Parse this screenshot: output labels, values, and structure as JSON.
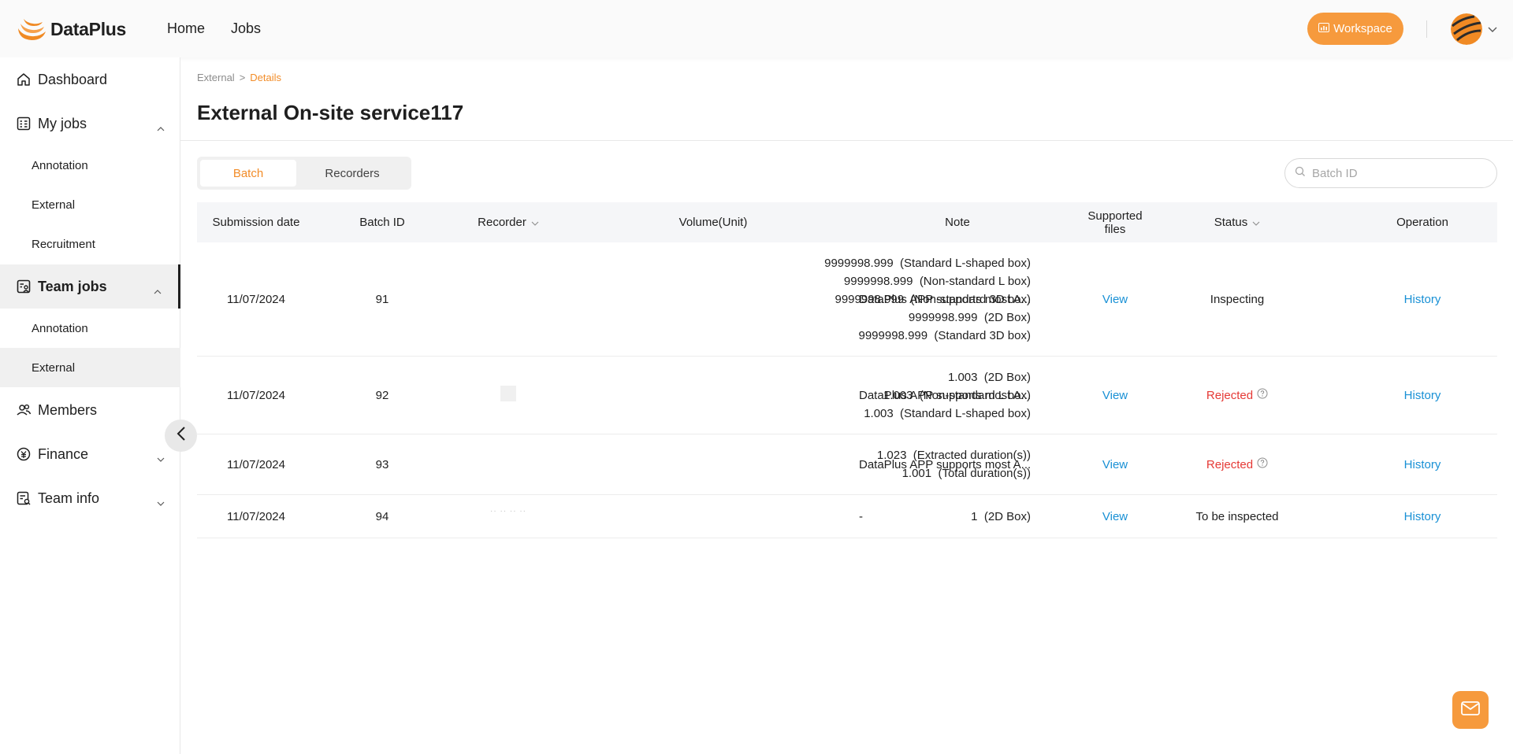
{
  "app": {
    "name": "DataPlus"
  },
  "topnav": [
    {
      "label": "Home"
    },
    {
      "label": "Jobs"
    }
  ],
  "header": {
    "workspace_label": "Workspace"
  },
  "sidebar": {
    "dashboard": "Dashboard",
    "my_jobs": "My jobs",
    "my_jobs_items": [
      "Annotation",
      "External",
      "Recruitment"
    ],
    "team_jobs": "Team jobs",
    "team_jobs_items": [
      "Annotation",
      "External"
    ],
    "members": "Members",
    "finance": "Finance",
    "team_info": "Team info"
  },
  "breadcrumb": {
    "parent": "External",
    "separator": ">",
    "current": "Details"
  },
  "page": {
    "title": "External On-site service117"
  },
  "tabs": [
    {
      "label": "Batch",
      "active": true
    },
    {
      "label": "Recorders",
      "active": false
    }
  ],
  "search": {
    "placeholder": "Batch ID",
    "value": ""
  },
  "table": {
    "headers": {
      "submission_date": "Submission date",
      "batch_id": "Batch ID",
      "recorder": "Recorder",
      "volume": "Volume(Unit)",
      "note": "Note",
      "supported_files_1": "Supported",
      "supported_files_2": "files",
      "status": "Status",
      "operation": "Operation"
    },
    "rows": [
      {
        "date": "11/07/2024",
        "batch_id": "91",
        "recorder": "",
        "volume": [
          "9999998.999  (Standard L-shaped box)",
          "9999998.999  (Non-standard L box)",
          "9999998.999  (Non-standard 3D box)",
          "9999998.999  (2D Box)",
          "9999998.999  (Standard 3D box)"
        ],
        "note": "DataPlus APP supports most A...",
        "files": "View",
        "status": "Inspecting",
        "operation": "History"
      },
      {
        "date": "11/07/2024",
        "batch_id": "92",
        "recorder": "",
        "volume": [
          "1.003  (2D Box)",
          "1.003  (Non-standard L box)",
          "1.003  (Standard L-shaped box)"
        ],
        "note": "DataPlus APP supports most A...",
        "files": "View",
        "status": "Rejected",
        "operation": "History"
      },
      {
        "date": "11/07/2024",
        "batch_id": "93",
        "recorder": "",
        "volume": [
          "1.023  (Extracted duration(s))",
          "1.001  (Total duration(s))"
        ],
        "note": "DataPlus APP supports most A...",
        "files": "View",
        "status": "Rejected",
        "operation": "History"
      },
      {
        "date": "11/07/2024",
        "batch_id": "94",
        "recorder": "",
        "volume": [
          "1  (2D Box)"
        ],
        "note": "-",
        "files": "View",
        "status": "To be inspected",
        "operation": "History"
      }
    ]
  },
  "colors": {
    "accent": "#f28c28",
    "link": "#1890d5",
    "rejected": "#e53935",
    "workspace": "#f69a3d"
  }
}
